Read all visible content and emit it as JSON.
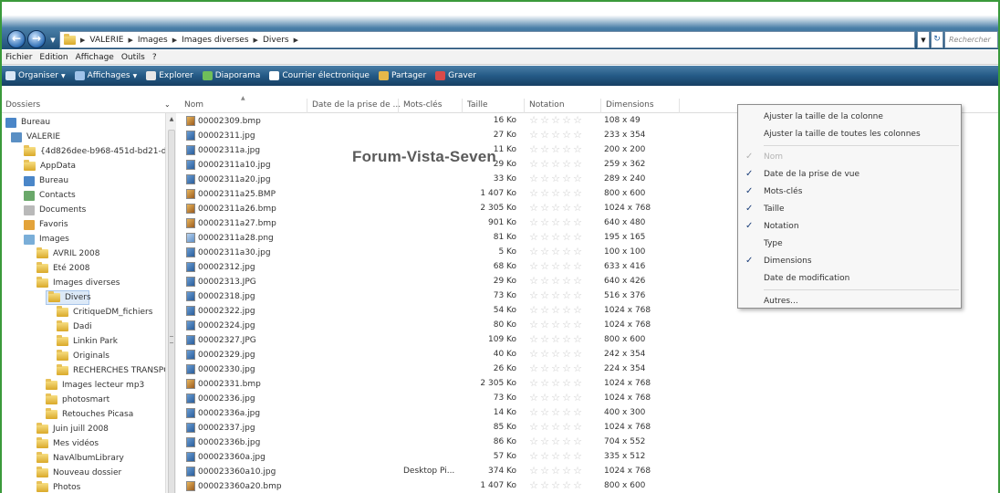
{
  "address": {
    "crumbs": [
      "VALERIE",
      "Images",
      "Images diverses",
      "Divers"
    ],
    "search_placeholder": "Rechercher"
  },
  "menubar": [
    "Fichier",
    "Edition",
    "Affichage",
    "Outils",
    "?"
  ],
  "commands": [
    {
      "label": "Organiser",
      "icon": "organize-icon",
      "dropdown": true,
      "color": "#d9e7f5"
    },
    {
      "label": "Affichages",
      "icon": "views-icon",
      "dropdown": true,
      "color": "#9fc3ea"
    },
    {
      "label": "Explorer",
      "icon": "explore-icon",
      "dropdown": false,
      "color": "#e8e8e8"
    },
    {
      "label": "Diaporama",
      "icon": "slideshow-icon",
      "dropdown": false,
      "color": "#6fbf5a"
    },
    {
      "label": "Courrier électronique",
      "icon": "email-icon",
      "dropdown": false,
      "color": "#ffffff"
    },
    {
      "label": "Partager",
      "icon": "share-icon",
      "dropdown": false,
      "color": "#e5b84a"
    },
    {
      "label": "Graver",
      "icon": "burn-icon",
      "dropdown": false,
      "color": "#d94a4a"
    }
  ],
  "folder_pane": {
    "header": "Dossiers",
    "items": [
      {
        "label": "Bureau",
        "icon": "desktop",
        "selected": false
      },
      {
        "label": "VALERIE",
        "icon": "user",
        "selected": false
      },
      {
        "label": "{4d826dee-b968-451d-bd21-d",
        "icon": "folder",
        "selected": false
      },
      {
        "label": "AppData",
        "icon": "folder",
        "selected": false
      },
      {
        "label": "Bureau",
        "icon": "desktop",
        "selected": false
      },
      {
        "label": "Contacts",
        "icon": "contacts",
        "selected": false
      },
      {
        "label": "Documents",
        "icon": "documents",
        "selected": false
      },
      {
        "label": "Favoris",
        "icon": "favorites",
        "selected": false
      },
      {
        "label": "Images",
        "icon": "pictures",
        "selected": false
      },
      {
        "label": "AVRIL 2008",
        "icon": "folder",
        "selected": false
      },
      {
        "label": "Eté 2008",
        "icon": "folder",
        "selected": false
      },
      {
        "label": "Images diverses",
        "icon": "folder",
        "selected": false
      },
      {
        "label": "Divers",
        "icon": "folder",
        "selected": true
      },
      {
        "label": "CritiqueDM_fichiers",
        "icon": "folder",
        "selected": false
      },
      {
        "label": "Dadi",
        "icon": "folder",
        "selected": false
      },
      {
        "label": "Linkin Park",
        "icon": "folder",
        "selected": false
      },
      {
        "label": "Originals",
        "icon": "folder",
        "selected": false
      },
      {
        "label": "RECHERCHES TRANSPO",
        "icon": "folder",
        "selected": false
      },
      {
        "label": "Images lecteur mp3",
        "icon": "folder",
        "selected": false
      },
      {
        "label": "photosmart",
        "icon": "folder",
        "selected": false
      },
      {
        "label": "Retouches Picasa",
        "icon": "folder",
        "selected": false
      },
      {
        "label": "Juin juill 2008",
        "icon": "folder",
        "selected": false
      },
      {
        "label": "Mes vidéos",
        "icon": "folder",
        "selected": false
      },
      {
        "label": "NavAlbumLibrary",
        "icon": "folder",
        "selected": false
      },
      {
        "label": "Nouveau dossier",
        "icon": "folder",
        "selected": false
      },
      {
        "label": "Photos",
        "icon": "folder",
        "selected": false
      }
    ]
  },
  "columns": {
    "nom": "Nom",
    "date": "Date de la prise de ...",
    "mots": "Mots-clés",
    "taille": "Taille",
    "notation": "Notation",
    "dimensions": "Dimensions"
  },
  "files": [
    {
      "name": "00002309.bmp",
      "type": "bmp",
      "tags": "",
      "size": "16 Ko",
      "dims": "108 x 49"
    },
    {
      "name": "00002311.jpg",
      "type": "jpg",
      "tags": "",
      "size": "27 Ko",
      "dims": "233 x 354"
    },
    {
      "name": "00002311a.jpg",
      "type": "jpg",
      "tags": "",
      "size": "11 Ko",
      "dims": "200 x 200"
    },
    {
      "name": "00002311a10.jpg",
      "type": "jpg",
      "tags": "",
      "size": "29 Ko",
      "dims": "259 x 362"
    },
    {
      "name": "00002311a20.jpg",
      "type": "jpg",
      "tags": "",
      "size": "33 Ko",
      "dims": "289 x 240"
    },
    {
      "name": "00002311a25.BMP",
      "type": "bmp",
      "tags": "",
      "size": "1 407 Ko",
      "dims": "800 x 600"
    },
    {
      "name": "00002311a26.bmp",
      "type": "bmp",
      "tags": "",
      "size": "2 305 Ko",
      "dims": "1024 x 768"
    },
    {
      "name": "00002311a27.bmp",
      "type": "bmp",
      "tags": "",
      "size": "901 Ko",
      "dims": "640 x 480"
    },
    {
      "name": "00002311a28.png",
      "type": "png",
      "tags": "",
      "size": "81 Ko",
      "dims": "195 x 165"
    },
    {
      "name": "00002311a30.jpg",
      "type": "jpg",
      "tags": "",
      "size": "5 Ko",
      "dims": "100 x 100"
    },
    {
      "name": "00002312.jpg",
      "type": "jpg",
      "tags": "",
      "size": "68 Ko",
      "dims": "633 x 416"
    },
    {
      "name": "00002313.JPG",
      "type": "jpg",
      "tags": "",
      "size": "29 Ko",
      "dims": "640 x 426"
    },
    {
      "name": "00002318.jpg",
      "type": "jpg",
      "tags": "",
      "size": "73 Ko",
      "dims": "516 x 376"
    },
    {
      "name": "00002322.jpg",
      "type": "jpg",
      "tags": "",
      "size": "54 Ko",
      "dims": "1024 x 768"
    },
    {
      "name": "00002324.jpg",
      "type": "jpg",
      "tags": "",
      "size": "80 Ko",
      "dims": "1024 x 768"
    },
    {
      "name": "00002327.JPG",
      "type": "jpg",
      "tags": "",
      "size": "109 Ko",
      "dims": "800 x 600"
    },
    {
      "name": "00002329.jpg",
      "type": "jpg",
      "tags": "",
      "size": "40 Ko",
      "dims": "242 x 354"
    },
    {
      "name": "00002330.jpg",
      "type": "jpg",
      "tags": "",
      "size": "26 Ko",
      "dims": "224 x 354"
    },
    {
      "name": "00002331.bmp",
      "type": "bmp",
      "tags": "",
      "size": "2 305 Ko",
      "dims": "1024 x 768"
    },
    {
      "name": "00002336.jpg",
      "type": "jpg",
      "tags": "",
      "size": "73 Ko",
      "dims": "1024 x 768"
    },
    {
      "name": "00002336a.jpg",
      "type": "jpg",
      "tags": "",
      "size": "14 Ko",
      "dims": "400 x 300"
    },
    {
      "name": "00002337.jpg",
      "type": "jpg",
      "tags": "",
      "size": "85 Ko",
      "dims": "1024 x 768"
    },
    {
      "name": "00002336b.jpg",
      "type": "jpg",
      "tags": "",
      "size": "86 Ko",
      "dims": "704 x 552"
    },
    {
      "name": "000023360a.jpg",
      "type": "jpg",
      "tags": "",
      "size": "57 Ko",
      "dims": "335 x 512"
    },
    {
      "name": "000023360a10.jpg",
      "type": "jpg",
      "tags": "Desktop Pi...",
      "size": "374 Ko",
      "dims": "1024 x 768"
    },
    {
      "name": "000023360a20.bmp",
      "type": "bmp",
      "tags": "",
      "size": "1 407 Ko",
      "dims": "800 x 600"
    }
  ],
  "rating_max": 5,
  "watermark": "Forum-Vista-Seven",
  "context_menu": {
    "top_items": [
      "Ajuster la taille de la colonne",
      "Ajuster la taille de toutes les colonnes"
    ],
    "columns": [
      {
        "label": "Nom",
        "checked": true,
        "disabled": true
      },
      {
        "label": "Date de la prise de vue",
        "checked": true,
        "disabled": false
      },
      {
        "label": "Mots-clés",
        "checked": true,
        "disabled": false
      },
      {
        "label": "Taille",
        "checked": true,
        "disabled": false
      },
      {
        "label": "Notation",
        "checked": true,
        "disabled": false
      },
      {
        "label": "Type",
        "checked": false,
        "disabled": false
      },
      {
        "label": "Dimensions",
        "checked": true,
        "disabled": false
      },
      {
        "label": "Date de modification",
        "checked": false,
        "disabled": false
      }
    ],
    "more": "Autres..."
  }
}
